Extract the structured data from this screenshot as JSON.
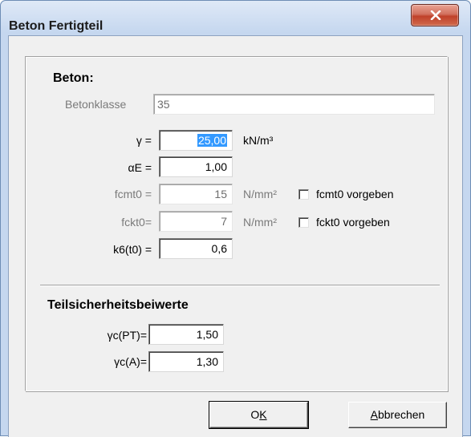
{
  "window": {
    "title": "Beton Fertigteil"
  },
  "beton": {
    "heading": "Beton:",
    "betonklasse_label": "Betonklasse",
    "betonklasse_value": "35",
    "gamma_label": "γ =",
    "gamma_value": "25,00",
    "gamma_unit": "kN/m³",
    "alphaE_label": "αE =",
    "alphaE_value": "1,00",
    "fcmt0_label": "fcmt0 =",
    "fcmt0_value": "15",
    "fcmt0_unit": "N/mm²",
    "fcmt0_checkbox_label": "fcmt0 vorgeben",
    "fckt0_label": "fckt0=",
    "fckt0_value": "7",
    "fckt0_unit": "N/mm²",
    "fckt0_checkbox_label": "fckt0 vorgeben",
    "k6_label": "k6(t0) =",
    "k6_value": "0,6"
  },
  "safety": {
    "heading": "Teilsicherheitsbeiwerte",
    "gammaPT_label": "γc(PT)=",
    "gammaPT_value": "1,50",
    "gammaA_label": "γc(A)=",
    "gammaA_value": "1,30"
  },
  "buttons": {
    "ok_pre": "O",
    "ok_mnemonic": "K",
    "cancel_mnemonic": "A",
    "cancel_rest": "bbrechen"
  }
}
